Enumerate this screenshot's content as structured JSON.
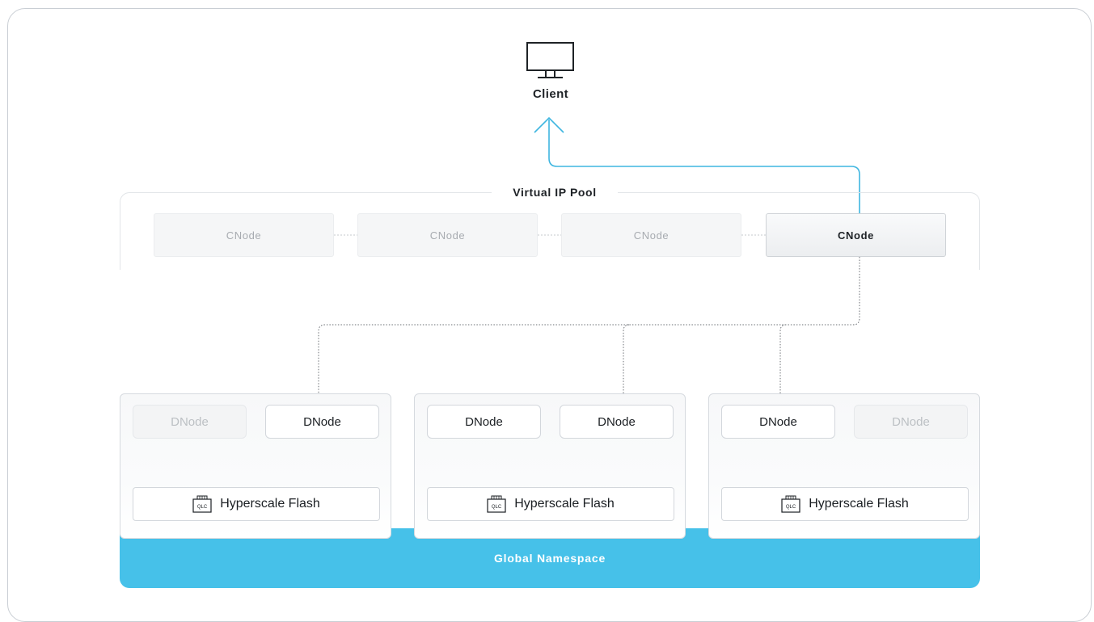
{
  "client": {
    "label": "Client",
    "icon": "monitor-icon"
  },
  "vip_pool": {
    "label": "Virtual IP Pool",
    "cnodes": [
      {
        "label": "CNode",
        "active": false
      },
      {
        "label": "CNode",
        "active": false
      },
      {
        "label": "CNode",
        "active": false
      },
      {
        "label": "CNode",
        "active": true
      }
    ]
  },
  "groups": [
    {
      "dnodes": [
        {
          "label": "DNode",
          "active": false
        },
        {
          "label": "DNode",
          "active": true
        }
      ],
      "flash": {
        "label": "Hyperscale Flash",
        "icon": "qlc-chip-icon",
        "chip_text": "QLC"
      }
    },
    {
      "dnodes": [
        {
          "label": "DNode",
          "active": true
        },
        {
          "label": "DNode",
          "active": true
        }
      ],
      "flash": {
        "label": "Hyperscale Flash",
        "icon": "qlc-chip-icon",
        "chip_text": "QLC"
      }
    },
    {
      "dnodes": [
        {
          "label": "DNode",
          "active": true
        },
        {
          "label": "DNode",
          "active": false
        }
      ],
      "flash": {
        "label": "Hyperscale Flash",
        "icon": "qlc-chip-icon",
        "chip_text": "QLC"
      }
    }
  ],
  "namespace": {
    "label": "Global Namespace"
  },
  "colors": {
    "accent": "#46c1e9",
    "arrow": "#3fb6e0",
    "inactive_text": "#a7abb0",
    "active_text": "#1e2226"
  }
}
